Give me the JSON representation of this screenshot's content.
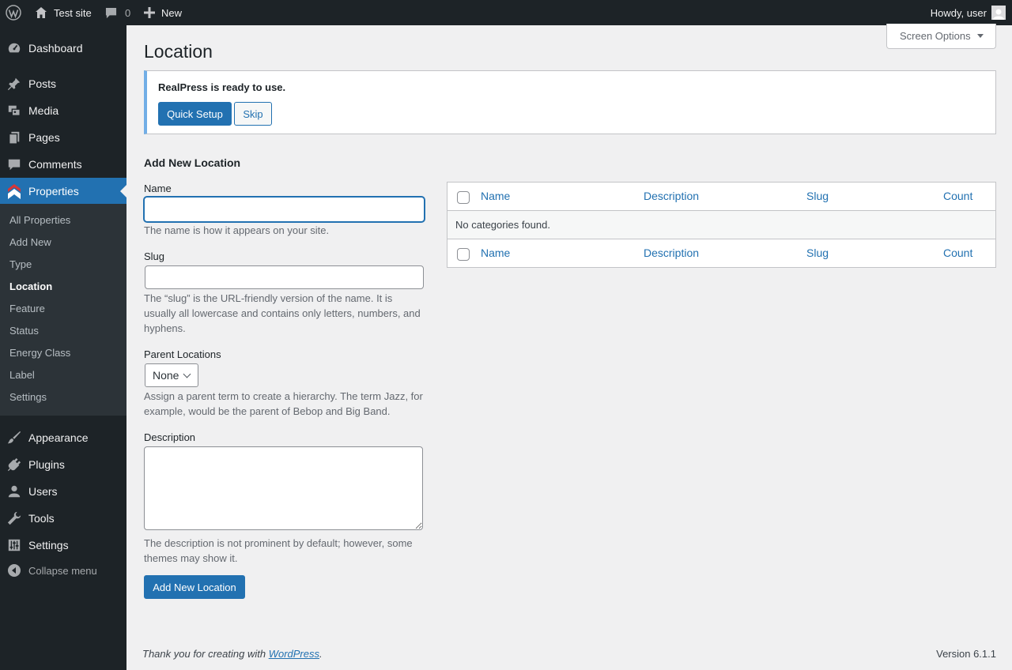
{
  "adminbar": {
    "site_name": "Test site",
    "comments_count": "0",
    "new_label": "New",
    "howdy": "Howdy, user"
  },
  "sidebar": {
    "items": [
      {
        "label": "Dashboard",
        "icon": "dashboard-icon"
      },
      {
        "label": "Posts",
        "icon": "pin-icon"
      },
      {
        "label": "Media",
        "icon": "media-icon"
      },
      {
        "label": "Pages",
        "icon": "pages-icon"
      },
      {
        "label": "Comments",
        "icon": "comment-icon"
      },
      {
        "label": "Properties",
        "icon": "properties-icon"
      },
      {
        "label": "Appearance",
        "icon": "brush-icon"
      },
      {
        "label": "Plugins",
        "icon": "plug-icon"
      },
      {
        "label": "Users",
        "icon": "user-icon"
      },
      {
        "label": "Tools",
        "icon": "wrench-icon"
      },
      {
        "label": "Settings",
        "icon": "sliders-icon"
      }
    ],
    "submenu": [
      "All Properties",
      "Add New",
      "Type",
      "Location",
      "Feature",
      "Status",
      "Energy Class",
      "Label",
      "Settings"
    ],
    "collapse_label": "Collapse menu"
  },
  "screen_options": "Screen Options",
  "page_title": "Location",
  "notice": {
    "text": "RealPress is ready to use.",
    "quick_setup": "Quick Setup",
    "skip": "Skip"
  },
  "form": {
    "title": "Add New Location",
    "name_label": "Name",
    "name_value": "",
    "name_help": "The name is how it appears on your site.",
    "slug_label": "Slug",
    "slug_value": "",
    "slug_help": "The “slug” is the URL-friendly version of the name. It is usually all lowercase and contains only letters, numbers, and hyphens.",
    "parent_label": "Parent Locations",
    "parent_value": "None",
    "parent_help": "Assign a parent term to create a hierarchy. The term Jazz, for example, would be the parent of Bebop and Big Band.",
    "description_label": "Description",
    "description_value": "",
    "description_help": "The description is not prominent by default; however, some themes may show it.",
    "submit": "Add New Location"
  },
  "table": {
    "columns": [
      "Name",
      "Description",
      "Slug",
      "Count"
    ],
    "empty": "No categories found."
  },
  "footer": {
    "thanks_prefix": "Thank you for creating with ",
    "link": "WordPress",
    "suffix": ".",
    "version": "Version 6.1.1"
  },
  "colors": {
    "adminbar_bg": "#1d2327",
    "accent": "#2271b1",
    "notice_border": "#72aee6"
  }
}
